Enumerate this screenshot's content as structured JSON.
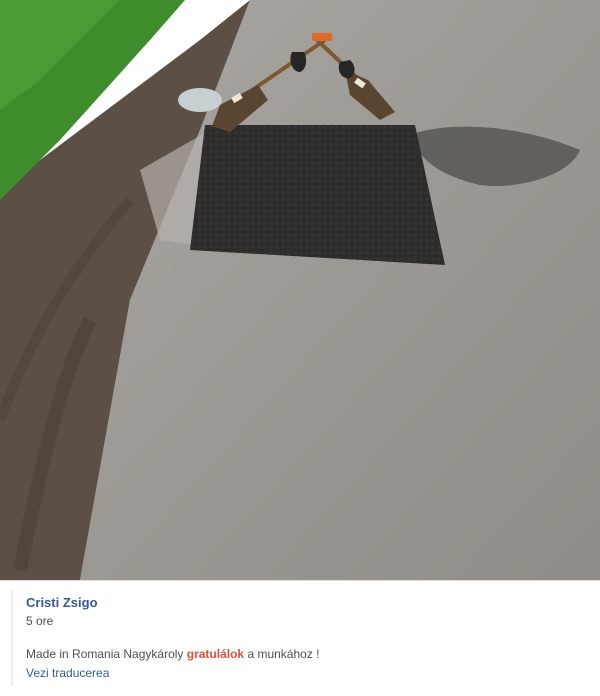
{
  "photo": {
    "alt": "Freshly patched pothole on a road with two brooms leaning together on top",
    "colors": {
      "asphalt": "#9b9791",
      "grass": "#3f8c2d",
      "dirt": "#5c5046",
      "patch": "#2e2d2c"
    }
  },
  "post": {
    "author": "Cristi Zsigo",
    "time": "5 ore",
    "message_prefix": "Made in Romania Nagykároly ",
    "message_highlight": "gratulálok",
    "message_suffix": " a munkához !",
    "translate_link": "Vezi traducerea"
  }
}
